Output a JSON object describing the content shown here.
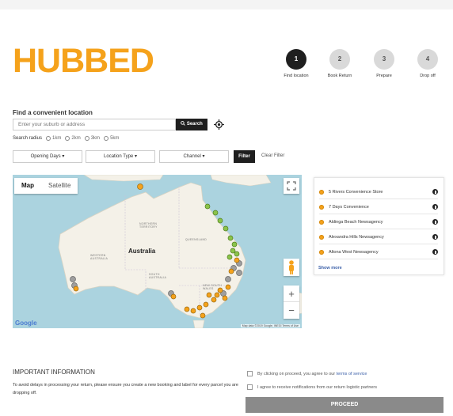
{
  "brand": {
    "logo_text": "HUBBED",
    "accent": "#f5a21b"
  },
  "stepper": [
    {
      "num": "1",
      "label": "Find location",
      "active": true
    },
    {
      "num": "2",
      "label": "Book Return",
      "active": false
    },
    {
      "num": "3",
      "label": "Prepare",
      "active": false
    },
    {
      "num": "4",
      "label": "Drop off",
      "active": false
    }
  ],
  "search": {
    "title": "Find a convenient location",
    "placeholder": "Enter your suburb or address",
    "button": "Search",
    "radius_label": "Search radius",
    "radius_options": [
      "1km",
      "2km",
      "3km",
      "5km"
    ]
  },
  "filters": {
    "opening_days": "Opening Days",
    "location_type": "Location Type",
    "channel": "Channel",
    "filter_button": "Filter",
    "clear": "Clear Filter"
  },
  "map": {
    "tab_map": "Map",
    "tab_satellite": "Satellite",
    "country_label": "Australia",
    "google": "Google",
    "attribution": "Map data ©2019 Google, INEGI    Terms of Use",
    "zoom_in": "+",
    "zoom_out": "−"
  },
  "locations": {
    "items": [
      "5 Rivers Convenience Store",
      "7 Days Convenience",
      "Aldinga Beach Newsagency",
      "Alexandra Hills Newsagency",
      "Altona West Newsagency"
    ],
    "show_more": "Show more"
  },
  "info": {
    "title": "IMPORTANT INFORMATION",
    "text": "To avoid delays in processing your return, please ensure you create a new booking and label for every parcel you are dropping off.",
    "agree_prefix": "By clicking on proceed, you agree to our ",
    "agree_link": "terms of service",
    "notify": "I agree to receive notifications from our return logistic partners",
    "proceed": "PROCEED"
  }
}
